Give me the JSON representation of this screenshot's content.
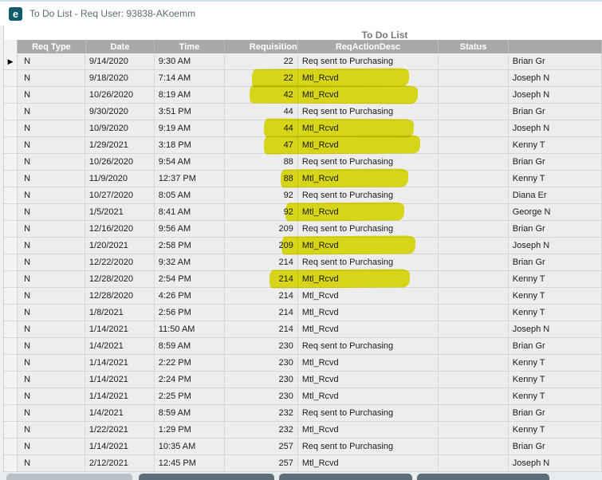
{
  "window": {
    "title": "To Do List - Req User: 93838-AKoemm",
    "app_icon_glyph": "e"
  },
  "grid": {
    "caption": "To Do List",
    "columns": [
      "",
      "Req Type",
      "Date",
      "Time",
      "Requisition",
      "ReqActionDesc",
      "Status",
      ""
    ],
    "rows": [
      {
        "req_type": "N",
        "date": "9/14/2020",
        "time": "9:30 AM",
        "requisition": "22",
        "action": "Req sent to Purchasing",
        "status": "",
        "name": "Brian Gr",
        "selected": true,
        "highlight": null
      },
      {
        "req_type": "N",
        "date": "9/18/2020",
        "time": "7:14 AM",
        "requisition": "22",
        "action": "Mtl_Rcvd",
        "status": "",
        "name": "Joseph N",
        "selected": false,
        "highlight": [
          316,
          513
        ]
      },
      {
        "req_type": "N",
        "date": "10/26/2020",
        "time": "8:19 AM",
        "requisition": "42",
        "action": "Mtl_Rcvd",
        "status": "",
        "name": "Joseph N",
        "selected": false,
        "highlight": [
          313,
          524
        ]
      },
      {
        "req_type": "N",
        "date": "9/30/2020",
        "time": "3:51 PM",
        "requisition": "44",
        "action": "Req sent to Purchasing",
        "status": "",
        "name": "Brian Gr",
        "selected": false,
        "highlight": null
      },
      {
        "req_type": "N",
        "date": "10/9/2020",
        "time": "9:19 AM",
        "requisition": "44",
        "action": "Mtl_Rcvd",
        "status": "",
        "name": "Joseph N",
        "selected": false,
        "highlight": [
          331,
          519
        ]
      },
      {
        "req_type": "N",
        "date": "1/29/2021",
        "time": "3:18 PM",
        "requisition": "47",
        "action": "Mtl_Rcvd",
        "status": "",
        "name": "Kenny T",
        "selected": false,
        "highlight": [
          331,
          527
        ]
      },
      {
        "req_type": "N",
        "date": "10/26/2020",
        "time": "9:54 AM",
        "requisition": "88",
        "action": "Req sent to Purchasing",
        "status": "",
        "name": "Brian Gr",
        "selected": false,
        "highlight": null
      },
      {
        "req_type": "N",
        "date": "11/9/2020",
        "time": "12:37 PM",
        "requisition": "88",
        "action": "Mtl_Rcvd",
        "status": "",
        "name": "Kenny T",
        "selected": false,
        "highlight": [
          352,
          512
        ]
      },
      {
        "req_type": "N",
        "date": "10/27/2020",
        "time": "8:05 AM",
        "requisition": "92",
        "action": "Req sent to Purchasing",
        "status": "",
        "name": "Diana Er",
        "selected": false,
        "highlight": null
      },
      {
        "req_type": "N",
        "date": "1/5/2021",
        "time": "8:41 AM",
        "requisition": "92",
        "action": "Mtl_Rcvd",
        "status": "",
        "name": "George N",
        "selected": false,
        "highlight": [
          358,
          507
        ]
      },
      {
        "req_type": "N",
        "date": "12/16/2020",
        "time": "9:56 AM",
        "requisition": "209",
        "action": "Req sent to Purchasing",
        "status": "",
        "name": "Brian Gr",
        "selected": false,
        "highlight": null
      },
      {
        "req_type": "N",
        "date": "1/20/2021",
        "time": "2:58 PM",
        "requisition": "209",
        "action": "Mtl_Rcvd",
        "status": "",
        "name": "Joseph N",
        "selected": false,
        "highlight": [
          353,
          521
        ]
      },
      {
        "req_type": "N",
        "date": "12/22/2020",
        "time": "9:32 AM",
        "requisition": "214",
        "action": "Req sent to Purchasing",
        "status": "",
        "name": "Brian Gr",
        "selected": false,
        "highlight": null
      },
      {
        "req_type": "N",
        "date": "12/28/2020",
        "time": "2:54 PM",
        "requisition": "214",
        "action": "Mtl_Rcvd",
        "status": "",
        "name": "Kenny T",
        "selected": false,
        "highlight": [
          338,
          514
        ]
      },
      {
        "req_type": "N",
        "date": "12/28/2020",
        "time": "4:26 PM",
        "requisition": "214",
        "action": "Mtl_Rcvd",
        "status": "",
        "name": "Kenny T",
        "selected": false,
        "highlight": null
      },
      {
        "req_type": "N",
        "date": "1/8/2021",
        "time": "2:56 PM",
        "requisition": "214",
        "action": "Mtl_Rcvd",
        "status": "",
        "name": "Kenny T",
        "selected": false,
        "highlight": null
      },
      {
        "req_type": "N",
        "date": "1/14/2021",
        "time": "11:50 AM",
        "requisition": "214",
        "action": "Mtl_Rcvd",
        "status": "",
        "name": "Joseph N",
        "selected": false,
        "highlight": null
      },
      {
        "req_type": "N",
        "date": "1/4/2021",
        "time": "8:59 AM",
        "requisition": "230",
        "action": "Req sent to Purchasing",
        "status": "",
        "name": "Brian Gr",
        "selected": false,
        "highlight": null
      },
      {
        "req_type": "N",
        "date": "1/14/2021",
        "time": "2:22 PM",
        "requisition": "230",
        "action": "Mtl_Rcvd",
        "status": "",
        "name": "Kenny T",
        "selected": false,
        "highlight": null
      },
      {
        "req_type": "N",
        "date": "1/14/2021",
        "time": "2:24 PM",
        "requisition": "230",
        "action": "Mtl_Rcvd",
        "status": "",
        "name": "Kenny T",
        "selected": false,
        "highlight": null
      },
      {
        "req_type": "N",
        "date": "1/14/2021",
        "time": "2:25 PM",
        "requisition": "230",
        "action": "Mtl_Rcvd",
        "status": "",
        "name": "Kenny T",
        "selected": false,
        "highlight": null
      },
      {
        "req_type": "N",
        "date": "1/4/2021",
        "time": "8:59 AM",
        "requisition": "232",
        "action": "Req sent to Purchasing",
        "status": "",
        "name": "Brian Gr",
        "selected": false,
        "highlight": null
      },
      {
        "req_type": "N",
        "date": "1/22/2021",
        "time": "1:29 PM",
        "requisition": "232",
        "action": "Mtl_Rcvd",
        "status": "",
        "name": "Kenny T",
        "selected": false,
        "highlight": null
      },
      {
        "req_type": "N",
        "date": "1/14/2021",
        "time": "10:35 AM",
        "requisition": "257",
        "action": "Req sent to Purchasing",
        "status": "",
        "name": "Brian Gr",
        "selected": false,
        "highlight": null
      },
      {
        "req_type": "N",
        "date": "2/12/2021",
        "time": "12:45 PM",
        "requisition": "257",
        "action": "Mtl_Rcvd",
        "status": "",
        "name": "Joseph N",
        "selected": false,
        "highlight": null
      }
    ]
  },
  "bottom_buttons": [
    {
      "label": "",
      "style": "light"
    },
    {
      "label": "",
      "style": "dark"
    },
    {
      "label": "",
      "style": "dark"
    },
    {
      "label": "",
      "style": "dark"
    }
  ],
  "colors": {
    "header_bg": "#a9a9a9",
    "highlighter_yellow": "#e6e200",
    "app_icon_teal": "#0d5b6c",
    "button_dark": "#5d6e79",
    "button_light": "#b9c0c6"
  }
}
